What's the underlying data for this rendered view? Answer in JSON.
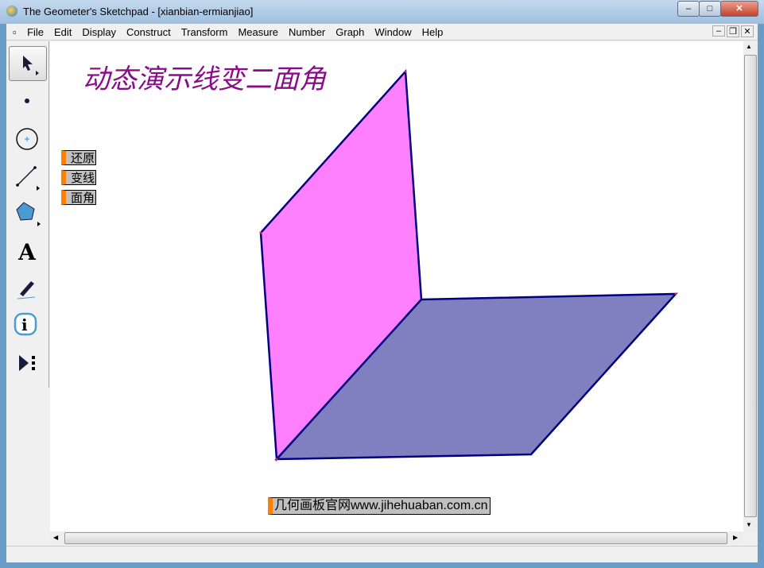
{
  "window": {
    "title": "The Geometer's Sketchpad - [xianbian-ermianjiao]",
    "buttons": [
      "minimize",
      "maximize",
      "close"
    ]
  },
  "menu": [
    "File",
    "Edit",
    "Display",
    "Construct",
    "Transform",
    "Measure",
    "Number",
    "Graph",
    "Window",
    "Help"
  ],
  "toolbar": [
    "arrow-select-icon",
    "point-icon",
    "compass-icon",
    "straightedge-icon",
    "polygon-icon",
    "text-icon",
    "marker-icon",
    "info-icon",
    "custom-tool-icon"
  ],
  "sketch": {
    "heading": "动态演示线变二面角",
    "buttons": [
      {
        "label": "还原"
      },
      {
        "label": "变线"
      },
      {
        "label": "面角"
      }
    ],
    "link": "几何画板官网www.jihehuaban.com.cn"
  },
  "colors": {
    "face1": "#ff80ff",
    "face2": "#8080c0",
    "edge": "#000080",
    "heading": "#8b0c8b",
    "button_handle": "#ff7f00"
  }
}
